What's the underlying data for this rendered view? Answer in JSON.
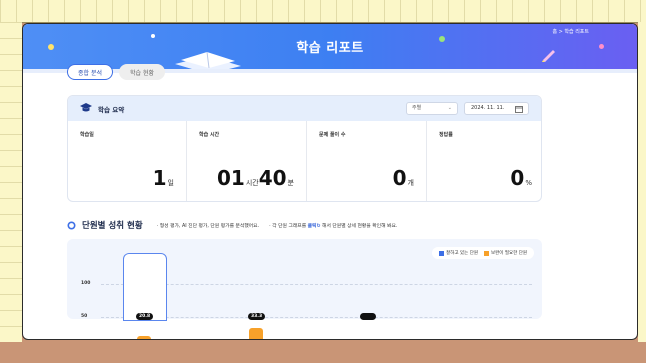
{
  "header": {
    "title": "학습 리포트",
    "breadcrumb": "홈 > 학습 리포트"
  },
  "tabs": [
    {
      "label": "종합 분석",
      "active": true
    },
    {
      "label": "학습 현황",
      "active": false
    }
  ],
  "summary": {
    "title": "학습 요약",
    "period_select": "주별",
    "date": "2024. 11. 11.",
    "stats": [
      {
        "label": "학습일",
        "value": "1",
        "unit": "일"
      },
      {
        "label": "학습 시간",
        "hours": "01",
        "hours_unit": "시간",
        "minutes": "40",
        "minutes_unit": "분"
      },
      {
        "label": "문제 풀이 수",
        "value": "0",
        "unit": "개"
      },
      {
        "label": "정답률",
        "value": "0",
        "unit": "%"
      }
    ]
  },
  "section": {
    "title": "단원별 성취 현황",
    "desc_1": "· 형성 평가, AI 진단 평가, 단원 평가를 분석했어요.",
    "desc_2_pre": "· 각 단원 그래프를",
    "desc_2_hl": "클릭",
    "desc_2_post": "해서 단원별 상세 현황을 확인해 봐요."
  },
  "chart_data": {
    "type": "bar",
    "legend": [
      "잘하고 있는 단원",
      "보완이 필요한 단원"
    ],
    "legend_colors": [
      "#3d6fe6",
      "#f7a12a"
    ],
    "y_ticks": [
      "100",
      "50"
    ],
    "ylim": [
      0,
      100
    ],
    "bars": [
      {
        "value": 20.8,
        "label": "20.8",
        "highlight": true
      },
      {
        "value": 33.3,
        "label": "33.3"
      },
      {
        "value": 0,
        "label": ""
      }
    ]
  }
}
